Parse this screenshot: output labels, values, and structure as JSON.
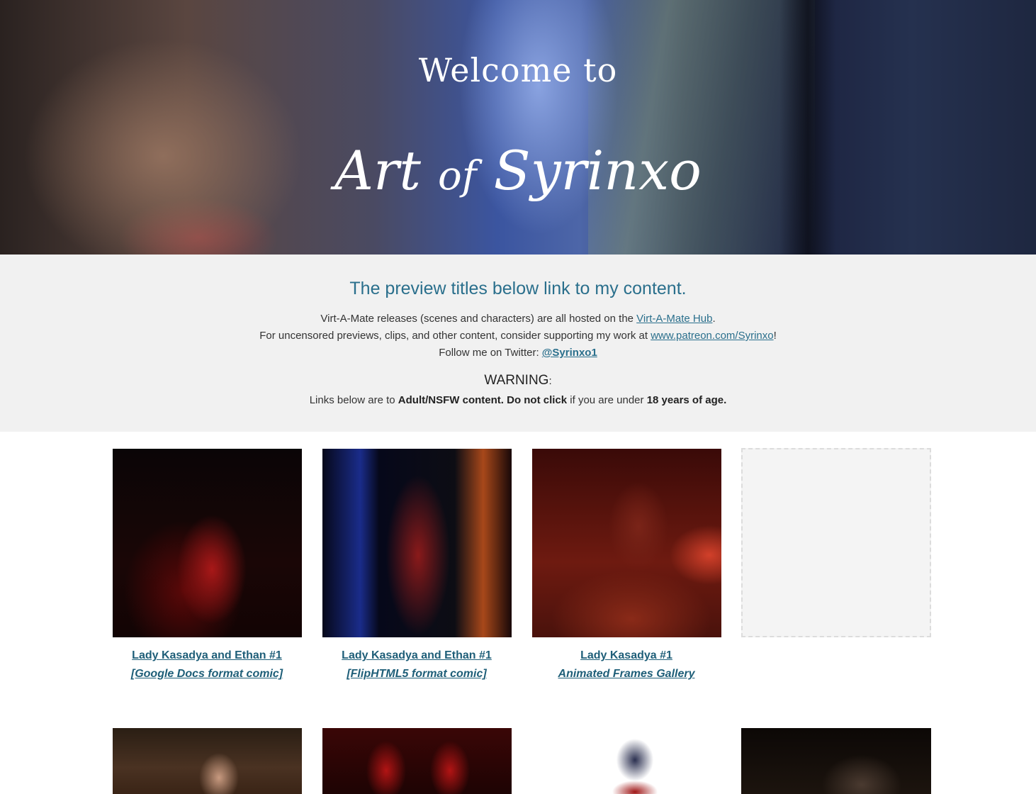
{
  "hero": {
    "welcome": "Welcome to",
    "title_part1": "Art",
    "title_of": "of",
    "title_part2": "Syrinxo"
  },
  "info": {
    "heading": "The preview titles below link to my content.",
    "line1_text": "Virt-A-Mate releases (scenes and characters) are all hosted on the ",
    "line1_link": "Virt-A-Mate Hub",
    "line1_end": ".",
    "line2_text": "For uncensored previews, clips, and other content, consider supporting my work at ",
    "line2_link": "www.patreon.com/Syrinxo",
    "line2_end": "!",
    "line3_text": "Follow me on Twitter: ",
    "line3_link": "@Syrinxo1",
    "warning_title": "WARNING",
    "warning_colon": ":",
    "warning_pre": "Links below are to ",
    "warning_bold1": "Adult/NSFW content. Do not click",
    "warning_mid": " if you are under ",
    "warning_bold2": "18 years of age."
  },
  "gallery": {
    "items": [
      {
        "title": "Lady Kasadya and Ethan #1",
        "subtitle": "[Google Docs format comic]"
      },
      {
        "title": "Lady Kasadya and Ethan #1",
        "subtitle": "[FlipHTML5 format comic]"
      },
      {
        "title": "Lady Kasadya #1 ",
        "subtitle": "Animated Frames Gallery"
      }
    ]
  }
}
